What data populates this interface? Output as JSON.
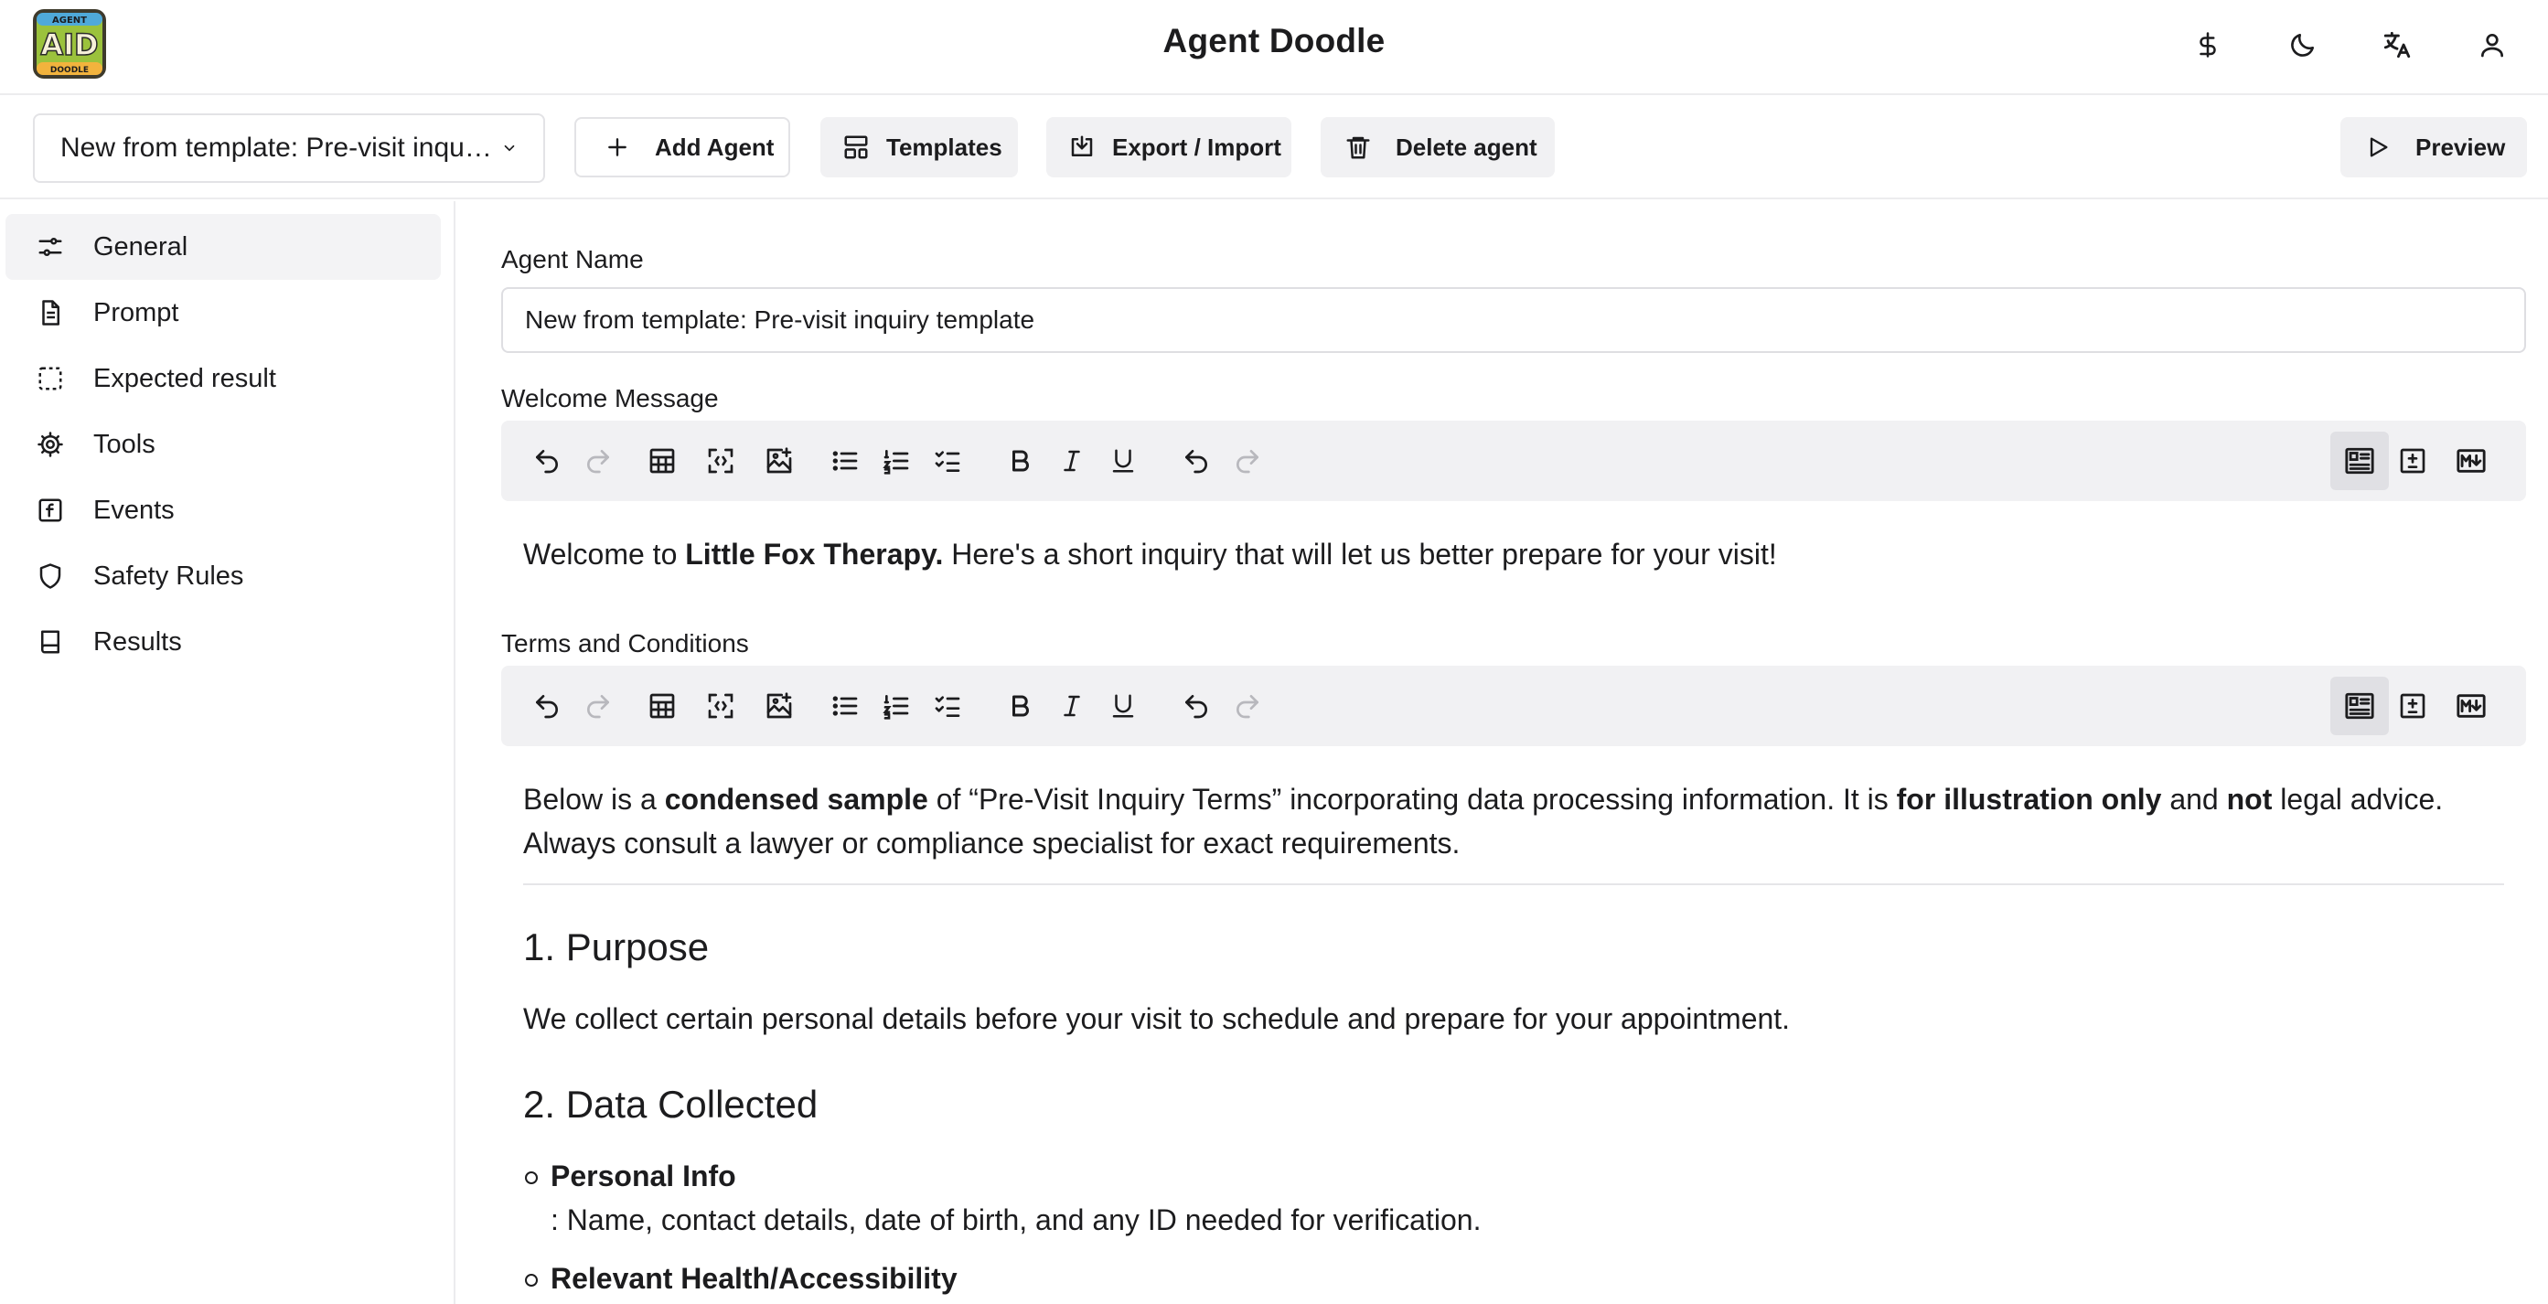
{
  "app": {
    "title": "Agent Doodle",
    "logo_text_top": "AGENT",
    "logo_text_mid": "AID",
    "logo_text_bottom": "DOODLE"
  },
  "header_icons": [
    "dollar-icon",
    "moon-icon",
    "translate-icon",
    "user-icon"
  ],
  "toolbar": {
    "agent_select_value": "New from template: Pre-visit inquiry template",
    "add_agent": "Add Agent",
    "templates": "Templates",
    "export_import": "Export / Import",
    "delete_agent": "Delete agent",
    "preview": "Preview"
  },
  "sidebar": {
    "items": [
      {
        "label": "General",
        "icon": "sliders-icon",
        "active": true
      },
      {
        "label": "Prompt",
        "icon": "document-icon",
        "active": false
      },
      {
        "label": "Expected result",
        "icon": "dashed-square-icon",
        "active": false
      },
      {
        "label": "Tools",
        "icon": "gear-icon",
        "active": false
      },
      {
        "label": "Events",
        "icon": "function-icon",
        "active": false
      },
      {
        "label": "Safety Rules",
        "icon": "shield-icon",
        "active": false
      },
      {
        "label": "Results",
        "icon": "book-icon",
        "active": false
      }
    ]
  },
  "form": {
    "agent_name_label": "Agent Name",
    "agent_name_value": "New from template: Pre-visit inquiry template",
    "welcome_label": "Welcome Message",
    "terms_label": "Terms and Conditions"
  },
  "welcome": {
    "t1": "Welcome to ",
    "b1": "Little Fox Therapy.",
    "t2": " Here's a short inquiry that will let us better prepare for your visit!"
  },
  "terms": {
    "p1_t1": "Below is a ",
    "p1_b1": "condensed sample",
    "p1_t2": " of “Pre-Visit Inquiry Terms” incorporating data processing information. It is ",
    "p1_b2": "for illustration only",
    "p1_t3": " and ",
    "p1_b3": "not",
    "p1_t4": " legal advice.",
    "p1_line2": "Always consult a lawyer or compliance specialist for exact requirements.",
    "h_purpose": "1. Purpose",
    "purpose_text": "We collect certain personal details before your visit to schedule and prepare for your appointment.",
    "h_data": "2. Data Collected",
    "li1_bold": "Personal Info",
    "li1_text": ": Name, contact details, date of birth, and any ID needed for verification.",
    "li2_bold": "Relevant Health/Accessibility"
  },
  "colors": {
    "text": "#1c1c1e",
    "border": "#e3e3e6",
    "toolbar_bg": "#f1f1f3",
    "active_bg": "#f3f3f5",
    "disabled_icon": "#b8b8bd"
  }
}
